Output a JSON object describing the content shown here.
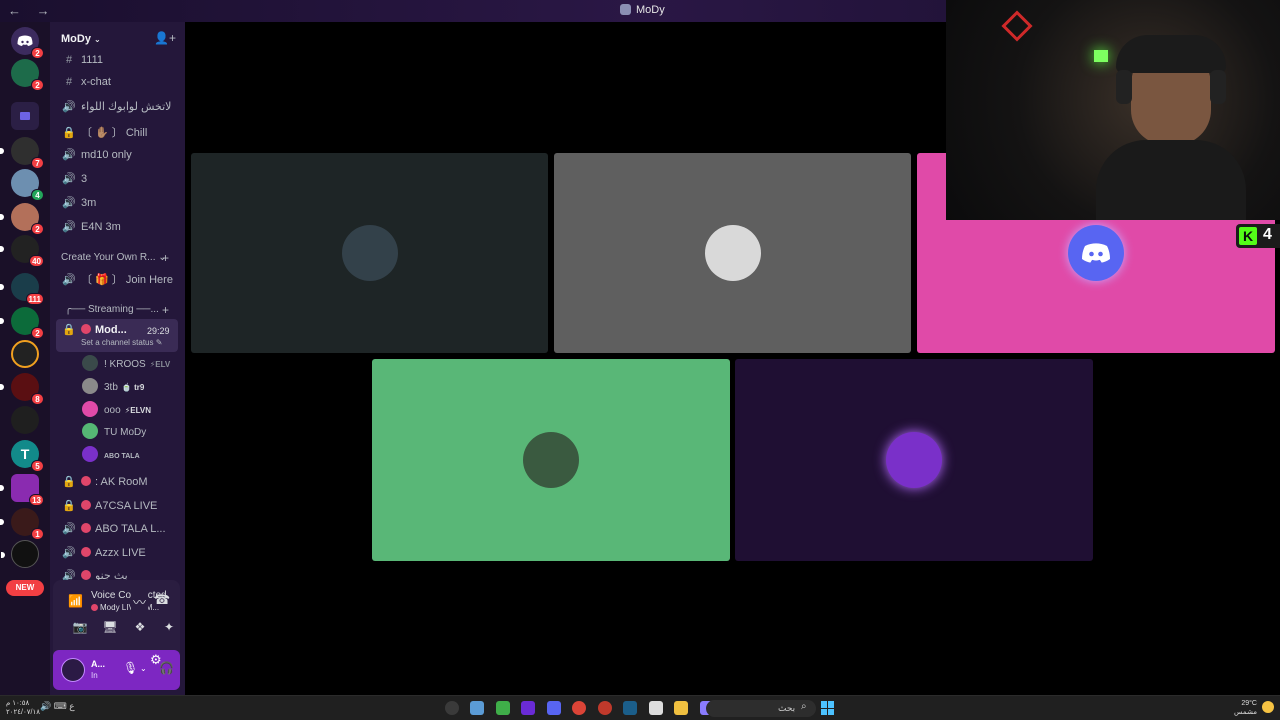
{
  "window": {
    "title": "MoDy",
    "back_arrows": "← →"
  },
  "server": {
    "name": "MoDy",
    "channels_top": [
      {
        "icon": "#",
        "label": "1111"
      },
      {
        "icon": "#",
        "label": "x-chat"
      },
      {
        "icon": "🔊",
        "label": "لاتخش لوابوك اللواء"
      },
      {
        "icon": "🔒",
        "label": "〔 ✋🏽 〕 Chill"
      },
      {
        "icon": "🔊",
        "label": "md10 only"
      },
      {
        "icon": "🔊",
        "label": "3"
      },
      {
        "icon": "🔊",
        "label": "3m"
      },
      {
        "icon": "🔊",
        "label": "E4N 3m"
      }
    ],
    "category_create": {
      "label": "Create Your Own R...",
      "chan": "〔 🎁 〕 Join Here"
    },
    "category_streaming": {
      "label": "╭── Streaming ──..."
    },
    "active_channel": {
      "label": "Mod...",
      "timer": "29:29",
      "status": "Set a channel status ✎"
    },
    "voice_users": [
      {
        "name": "! KROOS",
        "tag": "⚡ELV",
        "color": "#3a4a4a"
      },
      {
        "name": "3tb",
        "tag": "🍵 tr9",
        "color": "#8a8a8a"
      },
      {
        "name": "ooo",
        "tag": "⚡ELVN",
        "color": "#e04aa8"
      },
      {
        "name": "TU MoDy",
        "tag": "",
        "color": "#55b774"
      },
      {
        "name": "ABO TALA",
        "tag": "",
        "color": "#7a30c9"
      }
    ],
    "channels_bottom": [
      {
        "icon": "🔒",
        "label": ": AK RooM"
      },
      {
        "icon": "🔒",
        "label": "A7CSA LIVE"
      },
      {
        "icon": "🔊",
        "label": "ABO TALA L..."
      },
      {
        "icon": "🔊",
        "label": "Azzx LIVE"
      },
      {
        "icon": "🔊",
        "label": "بث جنو"
      }
    ]
  },
  "guild_badges": [
    "2",
    "2",
    "",
    "7",
    "4",
    "2",
    "40",
    "111",
    "2",
    "",
    "8",
    "",
    "5",
    "13",
    "1",
    ""
  ],
  "new_label": "NEW",
  "voice_panel": {
    "title": "Voice Connected",
    "subtitle": "Mody LIVE / M..."
  },
  "user_panel": {
    "name": "A...",
    "status": "In"
  },
  "tiles": [
    {
      "name": "tile-kroos",
      "bg": "#1e2526",
      "avatar": "#33414a"
    },
    {
      "name": "tile-3tb",
      "bg": "#5f5f5f",
      "avatar": "#d9d9d9"
    },
    {
      "name": "tile-ooo",
      "bg": "#e04aa8",
      "avatar": "#5865f2"
    },
    {
      "name": "tile-tu-mody",
      "bg": "#59b777",
      "avatar": "#3a5a40"
    },
    {
      "name": "tile-abo-tala",
      "bg": "#1f0f33",
      "avatar": "#7a30c9"
    }
  ],
  "kick": {
    "count": "4",
    "glyph": "K"
  },
  "taskbar": {
    "clock_time": "١٠:٥٨ م",
    "clock_date": "٢٠٢٤/٠٧/١٨",
    "search_placeholder": "بحث",
    "weather_temp": "29°C",
    "weather_desc": "مشمس",
    "sys_icons": "🔊 ⌨ ع"
  }
}
